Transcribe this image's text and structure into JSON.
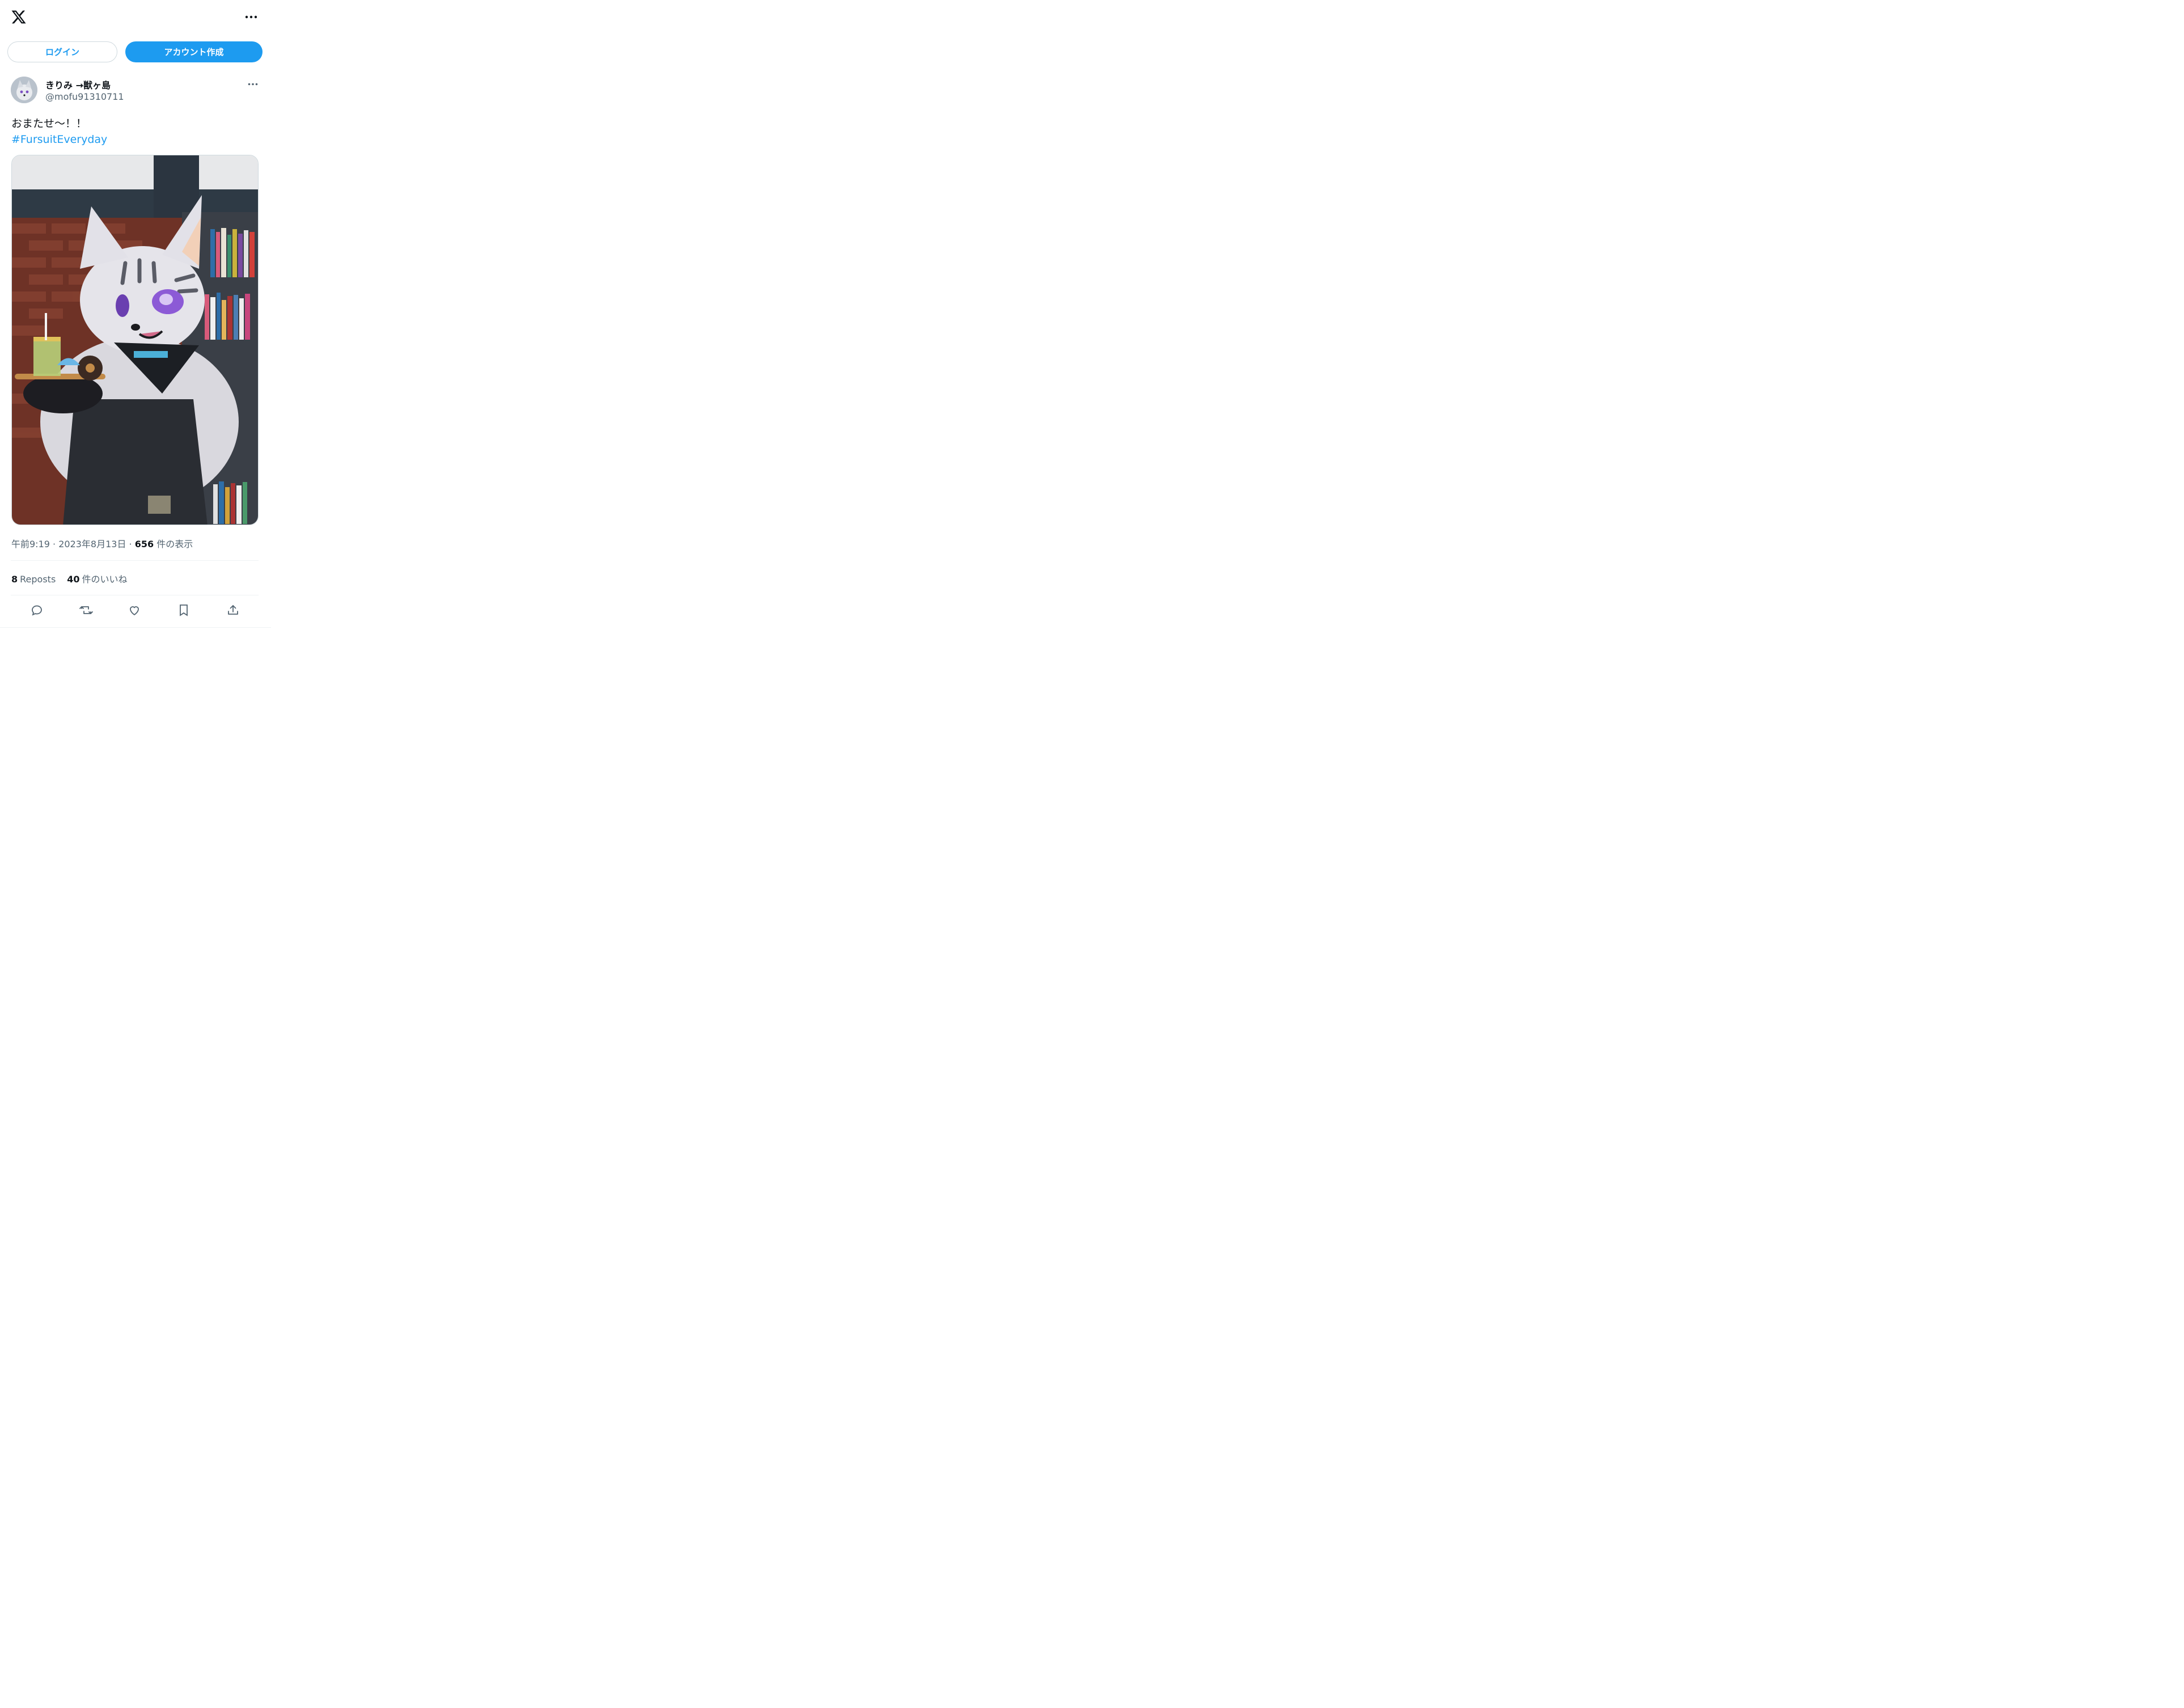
{
  "header": {
    "logo_icon": "x-logo-icon",
    "more_icon": "more-horizontal-icon"
  },
  "auth": {
    "login_label": "ログイン",
    "signup_label": "アカウント作成"
  },
  "tweet": {
    "author": {
      "display_name": "きりみ →獣ヶ島",
      "handle": "@mofu91310711"
    },
    "text_line1": "おまたせ〜！！",
    "hashtag": "#FursuitEveryday",
    "time": "午前9:19",
    "sep": " · ",
    "date": "2023年8月13日",
    "views_count": "656",
    "views_label": " 件の表示",
    "reposts_count": "8",
    "reposts_label": "Reposts",
    "likes_count": "40",
    "likes_label": "件のいいね"
  },
  "actions": [
    "reply-icon",
    "repost-icon",
    "like-icon",
    "bookmark-icon",
    "share-icon"
  ],
  "colors": {
    "accent": "#1d9bf0",
    "text": "#0f1419",
    "muted": "#536471",
    "border": "#cfd9de"
  }
}
